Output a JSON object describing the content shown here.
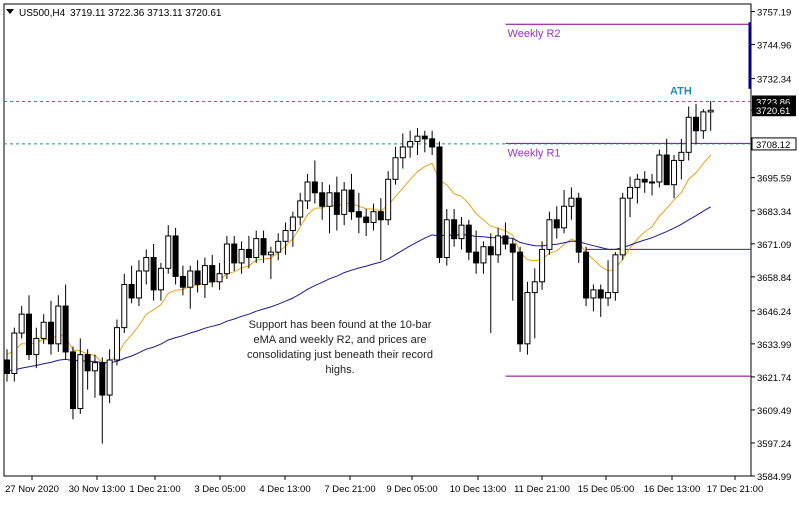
{
  "header": {
    "menu_arrow_icon": "triangle-down-icon",
    "symbol": "US500,H4",
    "ohlc": "3719.11 3722.36 3713.11 3720.61"
  },
  "annotation": "Support has been found at the 10-bar eMA and weekly R2, and prices are consolidating just beneath their record highs.",
  "colors": {
    "background": "#ffffff",
    "frame": "#000000",
    "candle_bull": "#ffffff",
    "candle_bear": "#000000",
    "ema_fast": "#e8a317",
    "ema_slow": "#1a1a8c",
    "pivot": "#800080",
    "pivot_label": "#9932cc",
    "ath_dash": "#2e8b8b",
    "ath_label": "#1f8fb5",
    "current_price_box": "#000000",
    "level_box": "#ffffff"
  },
  "chart_data": {
    "type": "candlestick",
    "title": "US500,H4",
    "ylim": [
      3584.99,
      3760
    ],
    "y_ticks": [
      "3757.19",
      "3744.96",
      "3732.34",
      "3720.61",
      "3708.12",
      "3695.59",
      "3683.34",
      "3671.09",
      "3658.84",
      "3646.24",
      "3633.99",
      "3621.74",
      "3609.49",
      "3597.24",
      "3584.99"
    ],
    "x_ticks": [
      "27 Nov 2020",
      "30 Nov 13:00",
      "1 Dec 21:00",
      "3 Dec 05:00",
      "4 Dec 13:00",
      "7 Dec 21:00",
      "9 Dec 05:00",
      "10 Dec 13:00",
      "11 Dec 21:00",
      "15 Dec 05:00",
      "16 Dec 13:00",
      "17 Dec 21:00"
    ],
    "price_tags": [
      {
        "label": "3723.86",
        "value": 3723.86,
        "style": "dark"
      },
      {
        "label": "3720.61",
        "value": 3720.61,
        "style": "current"
      },
      {
        "label": "3708.12",
        "value": 3708.12,
        "style": "light"
      }
    ],
    "levels": [
      {
        "name": "Weekly R2",
        "value": 3752.5,
        "x_start": 94
      },
      {
        "name": "Weekly R1",
        "value": 3708.3,
        "x_start": 94
      },
      {
        "name": "",
        "value": 3669.0,
        "x_start": 109
      },
      {
        "name": "",
        "value": 3622.0,
        "x_start": 94
      }
    ],
    "ath": {
      "label": "ATH",
      "value": 3723.86
    },
    "candles": [
      [
        3628.0,
        3632.0,
        3620.0,
        3623.0
      ],
      [
        3623.0,
        3640.0,
        3620.0,
        3638.0
      ],
      [
        3638.0,
        3648.0,
        3636.0,
        3645.0
      ],
      [
        3645.0,
        3652.0,
        3628.0,
        3630.0
      ],
      [
        3630.0,
        3640.0,
        3625.0,
        3636.0
      ],
      [
        3636.0,
        3645.0,
        3634.0,
        3642.0
      ],
      [
        3642.0,
        3650.0,
        3630.0,
        3634.0
      ],
      [
        3634.0,
        3652.0,
        3631.0,
        3648.0
      ],
      [
        3648.0,
        3656.0,
        3628.0,
        3631.0
      ],
      [
        3631.0,
        3633.0,
        3606.0,
        3610.0
      ],
      [
        3610.0,
        3636.0,
        3608.0,
        3630.0
      ],
      [
        3630.0,
        3632.0,
        3617.0,
        3624.0
      ],
      [
        3624.0,
        3630.0,
        3614.0,
        3627.0
      ],
      [
        3627.0,
        3629.0,
        3597.0,
        3615.0
      ],
      [
        3615.0,
        3632.0,
        3612.0,
        3628.0
      ],
      [
        3628.0,
        3643.0,
        3626.0,
        3640.0
      ],
      [
        3640.0,
        3660.0,
        3638.0,
        3656.0
      ],
      [
        3656.0,
        3663.0,
        3649.0,
        3651.0
      ],
      [
        3651.0,
        3665.0,
        3648.0,
        3661.0
      ],
      [
        3661.0,
        3669.0,
        3656.0,
        3666.0
      ],
      [
        3666.0,
        3671.0,
        3650.0,
        3654.0
      ],
      [
        3654.0,
        3664.0,
        3650.0,
        3662.0
      ],
      [
        3662.0,
        3678.0,
        3660.0,
        3674.0
      ],
      [
        3674.0,
        3677.0,
        3656.0,
        3659.0
      ],
      [
        3659.0,
        3663.0,
        3652.0,
        3655.0
      ],
      [
        3655.0,
        3663.0,
        3647.0,
        3661.0
      ],
      [
        3661.0,
        3665.0,
        3653.0,
        3656.0
      ],
      [
        3656.0,
        3666.0,
        3651.0,
        3663.0
      ],
      [
        3663.0,
        3667.0,
        3655.0,
        3657.0
      ],
      [
        3657.0,
        3664.0,
        3654.0,
        3660.0
      ],
      [
        3660.0,
        3674.0,
        3658.0,
        3671.0
      ],
      [
        3671.0,
        3674.0,
        3661.0,
        3664.0
      ],
      [
        3664.0,
        3672.0,
        3660.0,
        3669.0
      ],
      [
        3669.0,
        3674.0,
        3662.0,
        3666.0
      ],
      [
        3666.0,
        3676.0,
        3664.0,
        3673.0
      ],
      [
        3673.0,
        3676.0,
        3664.0,
        3667.0
      ],
      [
        3667.0,
        3670.0,
        3658.0,
        3668.0
      ],
      [
        3668.0,
        3675.0,
        3665.0,
        3672.0
      ],
      [
        3672.0,
        3679.0,
        3667.0,
        3676.0
      ],
      [
        3676.0,
        3683.0,
        3670.0,
        3681.0
      ],
      [
        3681.0,
        3690.0,
        3678.0,
        3687.0
      ],
      [
        3687.0,
        3697.0,
        3684.0,
        3694.0
      ],
      [
        3694.0,
        3702.0,
        3686.0,
        3690.0
      ],
      [
        3690.0,
        3694.0,
        3680.0,
        3685.0
      ],
      [
        3685.0,
        3693.0,
        3675.0,
        3690.0
      ],
      [
        3690.0,
        3696.0,
        3676.0,
        3682.0
      ],
      [
        3682.0,
        3694.0,
        3678.0,
        3691.0
      ],
      [
        3691.0,
        3697.0,
        3680.0,
        3683.0
      ],
      [
        3683.0,
        3690.0,
        3675.0,
        3681.0
      ],
      [
        3681.0,
        3684.0,
        3674.0,
        3679.0
      ],
      [
        3679.0,
        3686.0,
        3676.0,
        3683.0
      ],
      [
        3683.0,
        3688.0,
        3665.0,
        3680.0
      ],
      [
        3680.0,
        3698.0,
        3678.0,
        3695.0
      ],
      [
        3695.0,
        3707.0,
        3693.0,
        3703.0
      ],
      [
        3703.0,
        3712.0,
        3699.0,
        3707.0
      ],
      [
        3707.0,
        3713.0,
        3703.0,
        3709.0
      ],
      [
        3709.0,
        3714.0,
        3704.0,
        3711.0
      ],
      [
        3711.0,
        3713.0,
        3705.0,
        3710.0
      ],
      [
        3710.0,
        3713.0,
        3704.0,
        3707.0
      ],
      [
        3707.0,
        3709.0,
        3664.0,
        3666.0
      ],
      [
        3666.0,
        3684.0,
        3663.0,
        3680.0
      ],
      [
        3680.0,
        3684.0,
        3670.0,
        3673.0
      ],
      [
        3673.0,
        3681.0,
        3669.0,
        3678.0
      ],
      [
        3678.0,
        3680.0,
        3665.0,
        3668.0
      ],
      [
        3668.0,
        3676.0,
        3660.0,
        3664.0
      ],
      [
        3664.0,
        3672.0,
        3660.0,
        3670.0
      ],
      [
        3670.0,
        3675.0,
        3638.0,
        3667.0
      ],
      [
        3667.0,
        3677.0,
        3664.0,
        3674.0
      ],
      [
        3674.0,
        3679.0,
        3669.0,
        3671.0
      ],
      [
        3671.0,
        3673.0,
        3650.0,
        3668.0
      ],
      [
        3668.0,
        3670.0,
        3631.0,
        3634.0
      ],
      [
        3634.0,
        3657.0,
        3630.0,
        3653.0
      ],
      [
        3653.0,
        3662.0,
        3636.0,
        3657.0
      ],
      [
        3657.0,
        3672.0,
        3654.0,
        3669.0
      ],
      [
        3669.0,
        3683.0,
        3667.0,
        3680.0
      ],
      [
        3680.0,
        3685.0,
        3673.0,
        3677.0
      ],
      [
        3677.0,
        3691.0,
        3675.0,
        3685.0
      ],
      [
        3685.0,
        3692.0,
        3680.0,
        3688.0
      ],
      [
        3688.0,
        3690.0,
        3664.0,
        3668.0
      ],
      [
        3668.0,
        3670.0,
        3648.0,
        3651.0
      ],
      [
        3651.0,
        3656.0,
        3646.0,
        3654.0
      ],
      [
        3654.0,
        3656.0,
        3644.0,
        3651.0
      ],
      [
        3651.0,
        3665.0,
        3648.0,
        3653.0
      ],
      [
        3653.0,
        3668.0,
        3650.0,
        3667.0
      ],
      [
        3667.0,
        3690.0,
        3665.0,
        3688.0
      ],
      [
        3688.0,
        3696.0,
        3681.0,
        3692.0
      ],
      [
        3692.0,
        3697.0,
        3686.0,
        3695.0
      ],
      [
        3695.0,
        3698.0,
        3690.0,
        3694.0
      ],
      [
        3694.0,
        3697.0,
        3689.0,
        3694.0
      ],
      [
        3694.0,
        3706.0,
        3692.0,
        3704.0
      ],
      [
        3704.0,
        3710.0,
        3696.0,
        3693.0
      ],
      [
        3693.0,
        3704.0,
        3688.0,
        3702.0
      ],
      [
        3702.0,
        3710.0,
        3695.0,
        3705.0
      ],
      [
        3705.0,
        3722.0,
        3702.0,
        3718.0
      ],
      [
        3718.0,
        3723.0,
        3708.0,
        3713.0
      ],
      [
        3713.0,
        3721.0,
        3710.0,
        3720.0
      ],
      [
        3720.0,
        3724.0,
        3713.0,
        3720.6
      ]
    ],
    "ema_fast": [
      3630.0,
      3631.6,
      3634.1,
      3633.9,
      3634.3,
      3635.7,
      3635.4,
      3637.7,
      3636.5,
      3631.7,
      3631.4,
      3630.2,
      3629.7,
      3627.0,
      3627.2,
      3629.5,
      3634.3,
      3637.3,
      3640.8,
      3645.0,
      3646.6,
      3648.5,
      3652.8,
      3653.9,
      3654.1,
      3655.4,
      3655.5,
      3656.9,
      3656.9,
      3657.5,
      3660.0,
      3660.7,
      3662.2,
      3662.9,
      3665.0,
      3665.4,
      3665.8,
      3667.9,
      3670.2,
      3673.0,
      3677.3,
      3681.9,
      3684.3,
      3684.4,
      3685.4,
      3684.8,
      3686.1,
      3686.0,
      3685.0,
      3684.1,
      3684.0,
      3683.2,
      3685.4,
      3688.6,
      3691.7,
      3694.9,
      3697.9,
      3699.7,
      3700.9,
      3694.6,
      3693.0,
      3689.6,
      3688.7,
      3685.9,
      3682.2,
      3680.0,
      3677.6,
      3676.9,
      3675.9,
      3674.3,
      3667.9,
      3665.2,
      3664.8,
      3665.3,
      3667.6,
      3668.5,
      3670.8,
      3672.9,
      3671.6,
      3667.8,
      3665.3,
      3662.7,
      3661.0,
      3661.7,
      3665.6,
      3669.5,
      3672.9,
      3675.5,
      3677.4,
      3681.4,
      3684.2,
      3687.4,
      3690.1,
      3695.1,
      3697.4,
      3700.9,
      3704.0
    ],
    "ema_slow": [
      3624.0,
      3624.3,
      3625.0,
      3625.5,
      3626.0,
      3626.6,
      3627.1,
      3627.9,
      3628.3,
      3627.7,
      3627.8,
      3627.5,
      3627.5,
      3627.0,
      3627.0,
      3627.5,
      3628.6,
      3629.5,
      3630.7,
      3632.0,
      3632.8,
      3633.9,
      3635.4,
      3636.3,
      3637.0,
      3638.0,
      3638.8,
      3639.8,
      3640.5,
      3641.2,
      3642.4,
      3643.2,
      3644.2,
      3645.0,
      3646.1,
      3646.9,
      3647.7,
      3648.7,
      3649.8,
      3651.0,
      3652.5,
      3654.2,
      3655.6,
      3656.8,
      3658.1,
      3659.1,
      3660.4,
      3661.3,
      3662.1,
      3662.8,
      3663.6,
      3664.3,
      3665.5,
      3667.1,
      3668.7,
      3670.3,
      3671.8,
      3673.2,
      3674.4,
      3674.0,
      3674.3,
      3674.3,
      3674.5,
      3674.3,
      3673.8,
      3673.7,
      3673.4,
      3673.4,
      3673.3,
      3673.1,
      3671.6,
      3670.9,
      3670.4,
      3670.3,
      3670.7,
      3670.9,
      3671.5,
      3672.1,
      3671.9,
      3671.1,
      3670.4,
      3669.7,
      3669.1,
      3669.0,
      3669.7,
      3670.6,
      3671.6,
      3672.5,
      3673.3,
      3674.5,
      3675.6,
      3676.9,
      3678.3,
      3680.0,
      3681.5,
      3683.2,
      3684.8
    ]
  }
}
